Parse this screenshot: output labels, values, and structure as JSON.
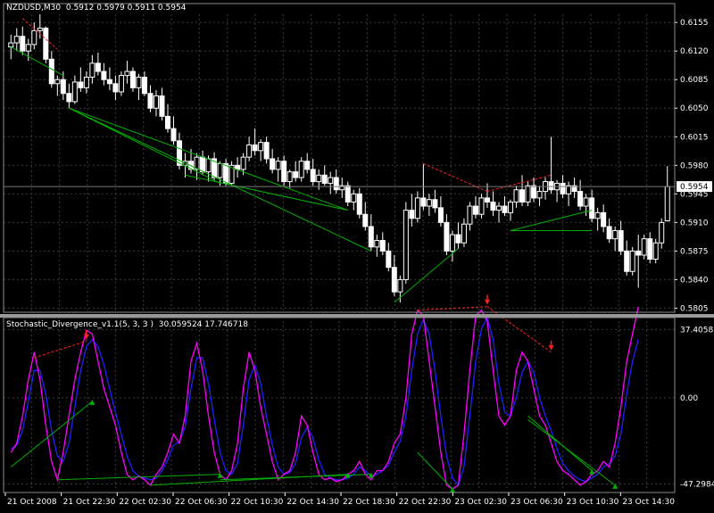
{
  "window": {
    "main_title": "NZDUSD,M30  0.5912 0.5979 0.5911 0.5954",
    "indicator_title": "Stochastic_Divergence_v1.1(5, 3, 3 )  30.059524 17.746718"
  },
  "colors": {
    "background": "#000000",
    "grid": "#3c3c3c",
    "candle": "#ffffff",
    "bull_divergence": "#00b000",
    "bear_divergence": "#ff2020",
    "main_line": "#ff00ff",
    "signal_line": "#2020ff",
    "price_tag_bg": "#ffffff",
    "price_tag_text": "#000000"
  },
  "chart_data": [
    {
      "type": "candlestick",
      "symbol": "NZDUSD",
      "timeframe": "M30",
      "ohlc_last": {
        "open": 0.5912,
        "high": 0.5979,
        "low": 0.5911,
        "close": 0.5954
      },
      "current_price_label": "0.5954",
      "ylim": [
        0.58,
        0.6165
      ],
      "y_ticks": [
        "0.6155",
        "0.6120",
        "0.6085",
        "0.6050",
        "0.6015",
        "0.5980",
        "0.5945",
        "0.5910",
        "0.5875",
        "0.5840",
        "0.5805"
      ],
      "x_tick_labels": [
        "21 Oct 2008",
        "21 Oct 22:30",
        "22 Oct 02:30",
        "22 Oct 06:30",
        "22 Oct 10:30",
        "22 Oct 14:30",
        "22 Oct 18:30",
        "22 Oct 22:30",
        "23 Oct 02:30",
        "23 Oct 06:30",
        "23 Oct 10:30",
        "23 Oct 14:30"
      ],
      "grid": true,
      "candles": [
        [
          0.6125,
          0.614,
          0.611,
          0.613
        ],
        [
          0.613,
          0.6148,
          0.612,
          0.6138
        ],
        [
          0.6138,
          0.615,
          0.6115,
          0.612
        ],
        [
          0.612,
          0.6135,
          0.6108,
          0.6128
        ],
        [
          0.6128,
          0.6155,
          0.6122,
          0.6145
        ],
        [
          0.6145,
          0.6165,
          0.6135,
          0.6148
        ],
        [
          0.6148,
          0.615,
          0.6105,
          0.611
        ],
        [
          0.611,
          0.612,
          0.6075,
          0.608
        ],
        [
          0.608,
          0.609,
          0.6065,
          0.6085
        ],
        [
          0.6085,
          0.6095,
          0.606,
          0.6068
        ],
        [
          0.6068,
          0.608,
          0.605,
          0.6058
        ],
        [
          0.6058,
          0.609,
          0.6055,
          0.6082
        ],
        [
          0.6082,
          0.61,
          0.607,
          0.6075
        ],
        [
          0.6075,
          0.6095,
          0.6068,
          0.6088
        ],
        [
          0.6088,
          0.6115,
          0.608,
          0.6105
        ],
        [
          0.6105,
          0.6118,
          0.609,
          0.6095
        ],
        [
          0.6095,
          0.6105,
          0.6078,
          0.6085
        ],
        [
          0.6085,
          0.61,
          0.6072,
          0.608
        ],
        [
          0.608,
          0.609,
          0.606,
          0.607
        ],
        [
          0.607,
          0.6095,
          0.6065,
          0.609
        ],
        [
          0.609,
          0.6108,
          0.608,
          0.6095
        ],
        [
          0.6095,
          0.61,
          0.607,
          0.6075
        ],
        [
          0.6075,
          0.6092,
          0.606,
          0.6088
        ],
        [
          0.6088,
          0.6095,
          0.6065,
          0.6068
        ],
        [
          0.6068,
          0.6078,
          0.6045,
          0.605
        ],
        [
          0.605,
          0.6072,
          0.604,
          0.6065
        ],
        [
          0.6065,
          0.6075,
          0.6035,
          0.604
        ],
        [
          0.604,
          0.6055,
          0.602,
          0.6025
        ],
        [
          0.6025,
          0.604,
          0.6005,
          0.601
        ],
        [
          0.601,
          0.602,
          0.5975,
          0.598
        ],
        [
          0.598,
          0.5995,
          0.5965,
          0.5985
        ],
        [
          0.5985,
          0.6,
          0.597,
          0.5975
        ],
        [
          0.5975,
          0.5995,
          0.5962,
          0.599
        ],
        [
          0.599,
          0.5998,
          0.5968,
          0.5972
        ],
        [
          0.5972,
          0.5992,
          0.596,
          0.5988
        ],
        [
          0.5988,
          0.5996,
          0.5962,
          0.5965
        ],
        [
          0.5965,
          0.5985,
          0.5955,
          0.5982
        ],
        [
          0.5982,
          0.5988,
          0.5955,
          0.5958
        ],
        [
          0.5958,
          0.5985,
          0.5955,
          0.598
        ],
        [
          0.598,
          0.599,
          0.5965,
          0.5975
        ],
        [
          0.5975,
          0.5995,
          0.5968,
          0.599
        ],
        [
          0.599,
          0.6015,
          0.5985,
          0.6005
        ],
        [
          0.6005,
          0.6025,
          0.5992,
          0.5998
        ],
        [
          0.5998,
          0.6012,
          0.5985,
          0.6008
        ],
        [
          0.6008,
          0.6015,
          0.5982,
          0.5988
        ],
        [
          0.5988,
          0.6,
          0.597,
          0.5975
        ],
        [
          0.5975,
          0.599,
          0.596,
          0.5985
        ],
        [
          0.5985,
          0.5992,
          0.5955,
          0.596
        ],
        [
          0.596,
          0.5975,
          0.5952,
          0.5972
        ],
        [
          0.5972,
          0.5985,
          0.596,
          0.5965
        ],
        [
          0.5965,
          0.599,
          0.596,
          0.5985
        ],
        [
          0.5985,
          0.5995,
          0.597,
          0.5975
        ],
        [
          0.5975,
          0.5988,
          0.5955,
          0.596
        ],
        [
          0.596,
          0.5975,
          0.595,
          0.5968
        ],
        [
          0.5968,
          0.598,
          0.5955,
          0.5958
        ],
        [
          0.5958,
          0.5972,
          0.5945,
          0.5965
        ],
        [
          0.5965,
          0.5975,
          0.5945,
          0.595
        ],
        [
          0.595,
          0.5965,
          0.594,
          0.5955
        ],
        [
          0.5955,
          0.596,
          0.593,
          0.5935
        ],
        [
          0.5935,
          0.595,
          0.5925,
          0.5945
        ],
        [
          0.5945,
          0.5952,
          0.5915,
          0.592
        ],
        [
          0.592,
          0.5935,
          0.59,
          0.5905
        ],
        [
          0.5905,
          0.592,
          0.5875,
          0.588
        ],
        [
          0.588,
          0.5895,
          0.5868,
          0.5888
        ],
        [
          0.5888,
          0.5898,
          0.587,
          0.5875
        ],
        [
          0.5875,
          0.5885,
          0.585,
          0.5855
        ],
        [
          0.5855,
          0.587,
          0.582,
          0.5825
        ],
        [
          0.5825,
          0.5845,
          0.5812,
          0.584
        ],
        [
          0.584,
          0.5935,
          0.5835,
          0.5925
        ],
        [
          0.5925,
          0.5945,
          0.5905,
          0.5915
        ],
        [
          0.5915,
          0.5948,
          0.591,
          0.594
        ],
        [
          0.594,
          0.5982,
          0.5925,
          0.593
        ],
        [
          0.593,
          0.5945,
          0.5918,
          0.5938
        ],
        [
          0.5938,
          0.595,
          0.5922,
          0.5928
        ],
        [
          0.5928,
          0.5942,
          0.5905,
          0.591
        ],
        [
          0.591,
          0.592,
          0.587,
          0.5875
        ],
        [
          0.5875,
          0.59,
          0.5862,
          0.5895
        ],
        [
          0.5895,
          0.591,
          0.5878,
          0.5885
        ],
        [
          0.5885,
          0.5915,
          0.588,
          0.5908
        ],
        [
          0.5908,
          0.5935,
          0.59,
          0.593
        ],
        [
          0.593,
          0.5942,
          0.5915,
          0.592
        ],
        [
          0.592,
          0.5945,
          0.5915,
          0.594
        ],
        [
          0.594,
          0.5958,
          0.5928,
          0.5935
        ],
        [
          0.5935,
          0.5948,
          0.5918,
          0.5925
        ],
        [
          0.5925,
          0.5935,
          0.591,
          0.593
        ],
        [
          0.593,
          0.5942,
          0.5918,
          0.5922
        ],
        [
          0.5922,
          0.5938,
          0.5912,
          0.5935
        ],
        [
          0.5935,
          0.5955,
          0.5928,
          0.595
        ],
        [
          0.595,
          0.5968,
          0.593,
          0.5935
        ],
        [
          0.5935,
          0.596,
          0.593,
          0.5955
        ],
        [
          0.5955,
          0.5965,
          0.5935,
          0.594
        ],
        [
          0.594,
          0.5955,
          0.593,
          0.5948
        ],
        [
          0.5948,
          0.5965,
          0.5938,
          0.596
        ],
        [
          0.596,
          0.6015,
          0.5945,
          0.595
        ],
        [
          0.595,
          0.5962,
          0.5935,
          0.5958
        ],
        [
          0.5958,
          0.5968,
          0.594,
          0.5945
        ],
        [
          0.5945,
          0.596,
          0.593,
          0.5955
        ],
        [
          0.5955,
          0.5965,
          0.594,
          0.5948
        ],
        [
          0.5948,
          0.5962,
          0.5925,
          0.593
        ],
        [
          0.593,
          0.5945,
          0.5918,
          0.594
        ],
        [
          0.594,
          0.595,
          0.591,
          0.5915
        ],
        [
          0.5915,
          0.5928,
          0.59,
          0.5922
        ],
        [
          0.5922,
          0.5932,
          0.5898,
          0.5905
        ],
        [
          0.5905,
          0.5915,
          0.5885,
          0.589
        ],
        [
          0.589,
          0.5905,
          0.5875,
          0.59
        ],
        [
          0.59,
          0.5912,
          0.587,
          0.5875
        ],
        [
          0.5875,
          0.5888,
          0.5845,
          0.585
        ],
        [
          0.585,
          0.588,
          0.5845,
          0.5875
        ],
        [
          0.5875,
          0.5895,
          0.583,
          0.587
        ],
        [
          0.587,
          0.5895,
          0.5865,
          0.589
        ],
        [
          0.589,
          0.5898,
          0.586,
          0.5865
        ],
        [
          0.5865,
          0.589,
          0.586,
          0.5885
        ],
        [
          0.5885,
          0.5915,
          0.5878,
          0.591
        ],
        [
          0.5912,
          0.5979,
          0.5911,
          0.5954
        ]
      ],
      "divergence_lines": [
        {
          "kind": "bearish",
          "from": [
            2,
            0.616
          ],
          "to": [
            8,
            0.6122
          ]
        },
        {
          "kind": "bullish",
          "from": [
            0,
            0.6125
          ],
          "to": [
            9,
            0.609
          ]
        },
        {
          "kind": "bullish",
          "from": [
            10,
            0.605
          ],
          "to": [
            36,
            0.5958
          ]
        },
        {
          "kind": "bullish",
          "from": [
            10,
            0.605
          ],
          "to": [
            58,
            0.5925
          ]
        },
        {
          "kind": "bullish",
          "from": [
            10,
            0.605
          ],
          "to": [
            62,
            0.5875
          ]
        },
        {
          "kind": "bullish",
          "from": [
            30,
            0.5968
          ],
          "to": [
            58,
            0.5925
          ]
        },
        {
          "kind": "bullish",
          "from": [
            66,
            0.5812
          ],
          "to": [
            77,
            0.5878
          ]
        },
        {
          "kind": "bearish",
          "from": [
            71,
            0.5982
          ],
          "to": [
            82,
            0.5948
          ]
        },
        {
          "kind": "bearish",
          "from": [
            82,
            0.5948
          ],
          "to": [
            93,
            0.5968
          ]
        },
        {
          "kind": "bullish",
          "from": [
            86,
            0.59
          ],
          "to": [
            100,
            0.5925
          ]
        },
        {
          "kind": "bullish",
          "from": [
            86,
            0.59
          ],
          "to": [
            100,
            0.59
          ]
        }
      ]
    },
    {
      "type": "line",
      "name": "Stochastic_Divergence_v1.1(5, 3, 3 )",
      "values_label": "30.059524 17.746718",
      "ylim": [
        -50,
        42
      ],
      "y_ticks": [
        "37.40585",
        "0.00",
        "-47.2984"
      ],
      "main": [
        -30,
        -25,
        -10,
        10,
        25,
        10,
        -15,
        -35,
        -45,
        -30,
        -10,
        10,
        25,
        37,
        35,
        20,
        5,
        -5,
        -15,
        -30,
        -42,
        -45,
        -43,
        -45,
        -48,
        -42,
        -38,
        -30,
        -20,
        -25,
        -10,
        20,
        30,
        15,
        -10,
        -30,
        -42,
        -45,
        -40,
        -25,
        5,
        25,
        15,
        -5,
        -20,
        -35,
        -45,
        -42,
        -40,
        -30,
        -10,
        -15,
        -30,
        -42,
        -45,
        -44,
        -46,
        -45,
        -42,
        -40,
        -35,
        -42,
        -45,
        -40,
        -40,
        -35,
        -25,
        -20,
        0,
        35,
        48,
        45,
        20,
        -5,
        -30,
        -48,
        -50,
        -48,
        -20,
        15,
        45,
        48,
        42,
        15,
        -10,
        -15,
        -10,
        15,
        25,
        20,
        5,
        -10,
        -15,
        -25,
        -35,
        -40,
        -42,
        -45,
        -48,
        -46,
        -42,
        -40,
        -35,
        -38,
        -25,
        -5,
        20,
        35,
        50
      ],
      "signal": [
        -28,
        -26,
        -18,
        -2,
        15,
        15,
        2,
        -18,
        -32,
        -35,
        -25,
        -5,
        15,
        28,
        32,
        28,
        18,
        5,
        -8,
        -20,
        -32,
        -40,
        -43,
        -44,
        -45,
        -44,
        -40,
        -34,
        -26,
        -24,
        -16,
        5,
        22,
        22,
        8,
        -12,
        -30,
        -40,
        -42,
        -36,
        -15,
        10,
        18,
        8,
        -10,
        -26,
        -38,
        -42,
        -41,
        -36,
        -22,
        -16,
        -22,
        -34,
        -42,
        -44,
        -45,
        -45,
        -44,
        -42,
        -38,
        -40,
        -43,
        -42,
        -40,
        -37,
        -30,
        -24,
        -10,
        15,
        35,
        43,
        35,
        15,
        -10,
        -32,
        -44,
        -48,
        -38,
        -10,
        20,
        38,
        44,
        32,
        8,
        -8,
        -10,
        0,
        14,
        20,
        14,
        0,
        -10,
        -18,
        -28,
        -36,
        -40,
        -43,
        -45,
        -46,
        -44,
        -42,
        -38,
        -36,
        -32,
        -20,
        2,
        20,
        32
      ],
      "divergence_lines": [
        {
          "kind": "bearish",
          "from": [
            4,
            22
          ],
          "to": [
            13,
            31
          ],
          "arrow_at": [
            13,
            31
          ]
        },
        {
          "kind": "bullish",
          "from": [
            0,
            -38
          ],
          "to": [
            14,
            -2
          ]
        },
        {
          "kind": "bullish",
          "from": [
            8,
            -45
          ],
          "to": [
            36,
            -42
          ]
        },
        {
          "kind": "bullish",
          "from": [
            24,
            -48
          ],
          "to": [
            58,
            -42
          ]
        },
        {
          "kind": "bullish",
          "from": [
            36,
            -45
          ],
          "to": [
            62,
            -42
          ]
        },
        {
          "kind": "bearish",
          "from": [
            70,
            48
          ],
          "to": [
            82,
            50
          ],
          "arrow_at": [
            82,
            50
          ]
        },
        {
          "kind": "bearish",
          "from": [
            82,
            50
          ],
          "to": [
            93,
            25
          ],
          "arrow_at": [
            93,
            25
          ]
        },
        {
          "kind": "bullish",
          "from": [
            70,
            -30
          ],
          "to": [
            76,
            -50
          ]
        },
        {
          "kind": "bullish",
          "from": [
            89,
            -10
          ],
          "to": [
            100,
            -40
          ]
        },
        {
          "kind": "bullish",
          "from": [
            89,
            -12
          ],
          "to": [
            104,
            -48
          ]
        }
      ]
    }
  ]
}
